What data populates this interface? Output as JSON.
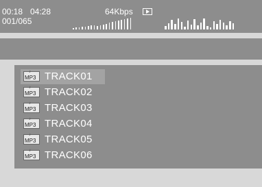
{
  "status": {
    "elapsed": "00:18",
    "total": "04:28",
    "bitrate": "64Kbps",
    "track_counter": "001/065",
    "mode_icon": "play-icon"
  },
  "tracks": [
    {
      "label": "TRACK01",
      "icon": "MP3",
      "selected": true
    },
    {
      "label": "TRACK02",
      "icon": "MP3",
      "selected": false
    },
    {
      "label": "TRACK03",
      "icon": "MP3",
      "selected": false
    },
    {
      "label": "TRACK04",
      "icon": "MP3",
      "selected": false
    },
    {
      "label": "TRACK05",
      "icon": "MP3",
      "selected": false
    },
    {
      "label": "TRACK06",
      "icon": "MP3",
      "selected": false
    }
  ],
  "colors": {
    "panel": "#8d8d8d",
    "background": "#d8d8d8",
    "highlight": "#a3a3a3",
    "text": "#ffffff"
  }
}
